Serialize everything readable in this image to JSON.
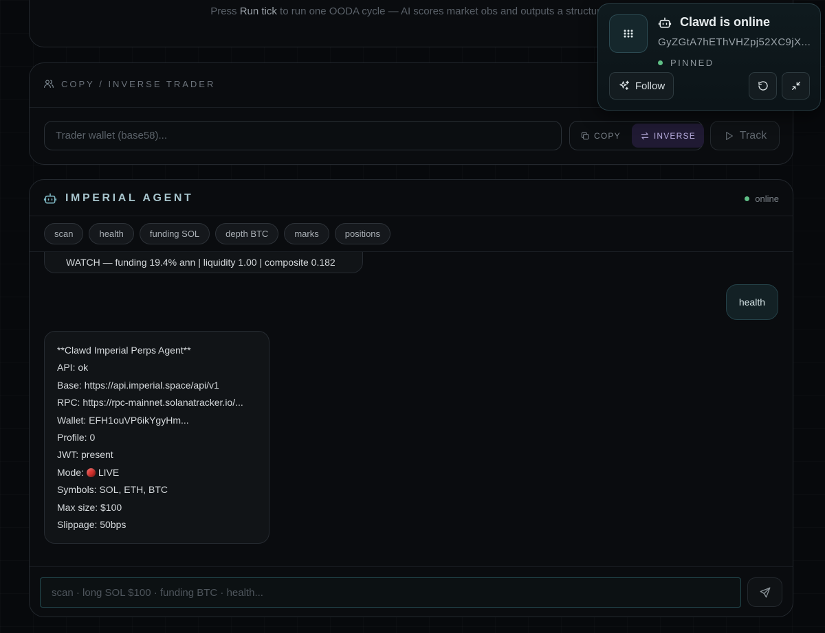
{
  "top_hint": {
    "prefix": "Press ",
    "action": "Run tick",
    "suffix": " to run one OODA cycle — AI scores market obs and outputs a structured"
  },
  "copy_trader": {
    "title": "COPY / INVERSE TRADER",
    "wallet_placeholder": "Trader wallet (base58)...",
    "copy_label": "COPY",
    "inverse_label": "INVERSE",
    "active_mode": "INVERSE",
    "track_label": "Track"
  },
  "agent": {
    "title": "IMPERIAL AGENT",
    "status": "online",
    "quick_commands": [
      "scan",
      "health",
      "funding SOL",
      "depth BTC",
      "marks",
      "positions"
    ],
    "messages": {
      "previous_bot_tail": "WATCH — funding 19.4% ann | liquidity 1.00 | composite 0.182",
      "user": "health",
      "bot_lines": [
        "**Clawd Imperial Perps Agent**",
        "API: ok",
        "Base: https://api.imperial.space/api/v1",
        "RPC: https://rpc-mainnet.solanatracker.io/...",
        "Wallet: EFH1ouVP6ikYgyHm...",
        "Profile: 0",
        "JWT: present",
        "Mode: ",
        "Symbols: SOL, ETH, BTC",
        "Max size: $100",
        "Slippage: 50bps"
      ],
      "mode_value": "LIVE"
    },
    "input_placeholder": "scan · long SOL $100 · funding BTC · health..."
  },
  "widget": {
    "title": "Clawd is online",
    "address": "GyZGtA7hEThVHZpj52XC9jX...",
    "pinned_label": "PINNED",
    "follow_label": "Follow"
  },
  "colors": {
    "online_dot": "#5fbf86",
    "live_dot": "#d8322e",
    "accent_teal": "#a7c4cc",
    "inverse_active": "#b9aee0"
  }
}
